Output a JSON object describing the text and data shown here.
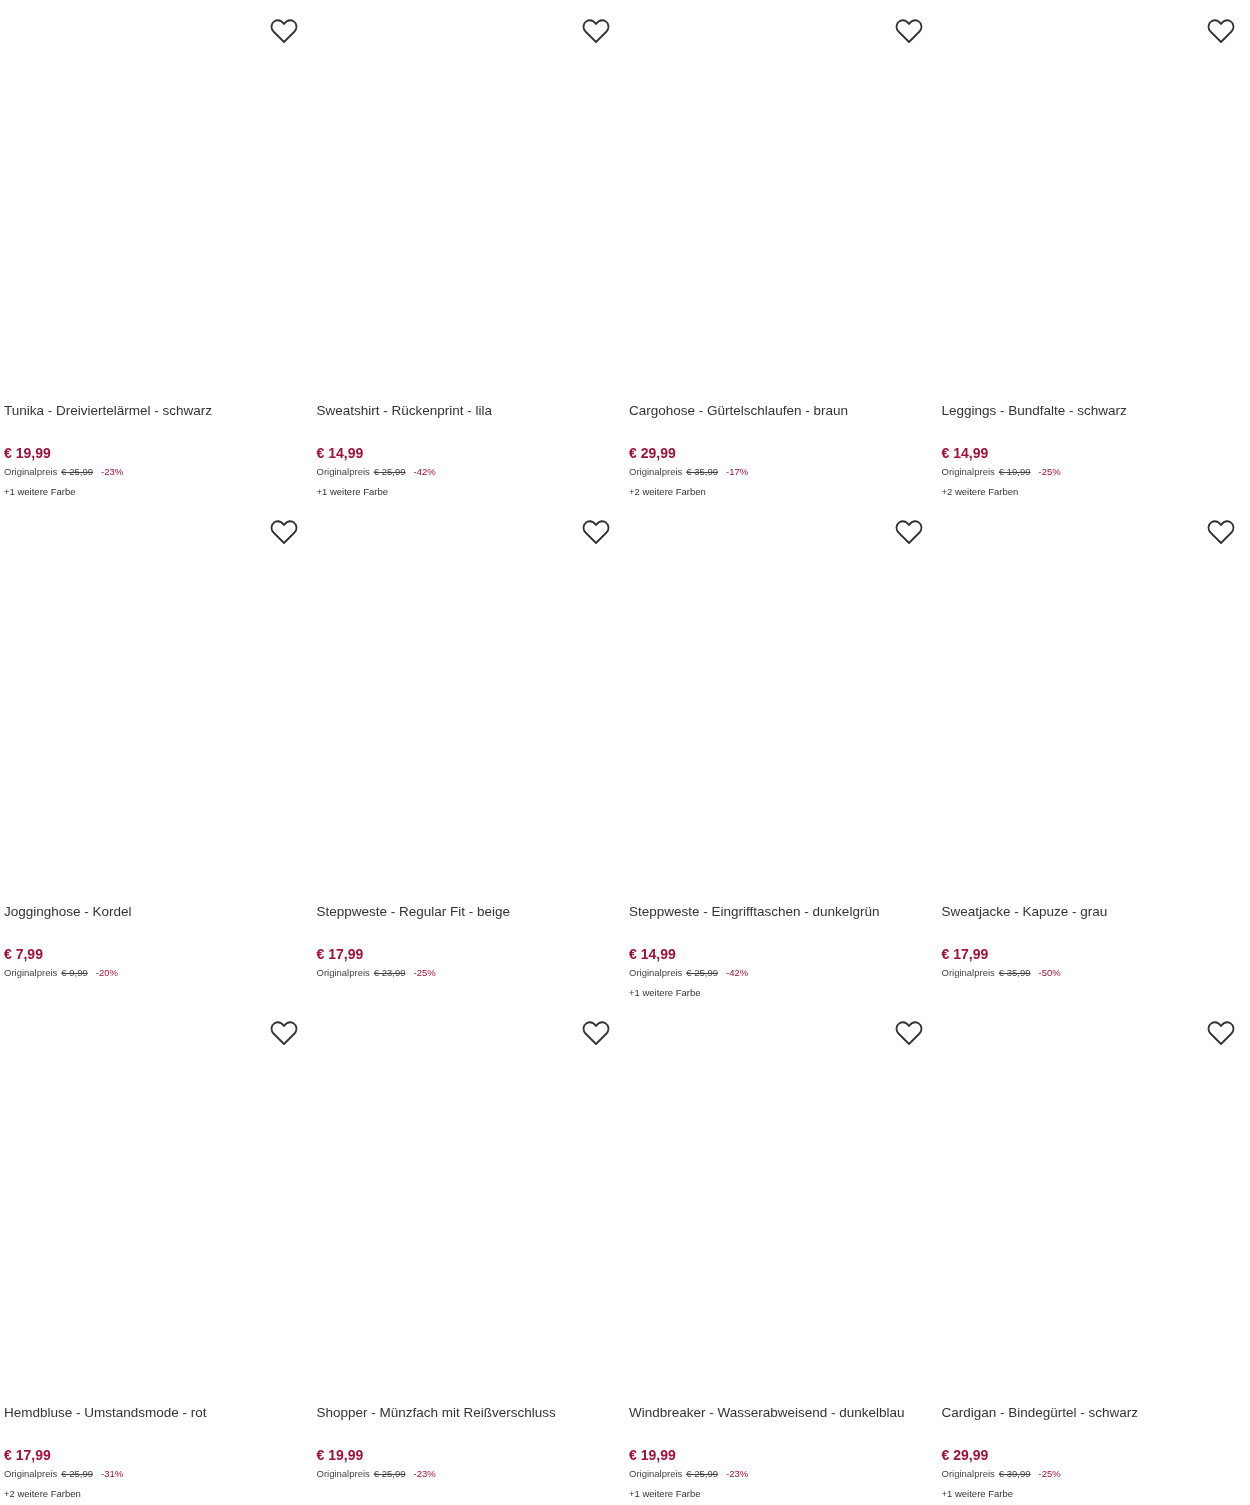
{
  "products": [
    {
      "title": "Tunika - Dreiviertelärmel - schwarz",
      "price": "€ 19,99",
      "original_label": "Originalpreis",
      "original_price": "€ 25,99",
      "discount": "-23%",
      "more_colors": "+1 weitere Farbe",
      "favorite": false
    },
    {
      "title": "Sweatshirt - Rückenprint - lila",
      "price": "€ 14,99",
      "original_label": "Originalpreis",
      "original_price": "€ 25,99",
      "discount": "-42%",
      "more_colors": "+1 weitere Farbe",
      "favorite": false
    },
    {
      "title": "Cargohose - Gürtelschlaufen - braun",
      "price": "€ 29,99",
      "original_label": "Originalpreis",
      "original_price": "€ 35,99",
      "discount": "-17%",
      "more_colors": "+2 weitere Farben",
      "favorite": false
    },
    {
      "title": "Leggings - Bundfalte - schwarz",
      "price": "€ 14,99",
      "original_label": "Originalpreis",
      "original_price": "€ 19,99",
      "discount": "-25%",
      "more_colors": "+2 weitere Farben",
      "favorite": false
    },
    {
      "title": "Jogginghose - Kordel",
      "price": "€ 7,99",
      "original_label": "Originalpreis",
      "original_price": "€ 9,99",
      "discount": "-20%",
      "favorite": false
    },
    {
      "title": "Steppweste - Regular Fit - beige",
      "price": "€ 17,99",
      "original_label": "Originalpreis",
      "original_price": "€ 23,99",
      "discount": "-25%",
      "favorite": false
    },
    {
      "title": "Steppweste - Eingrifftaschen - dunkelgrün",
      "price": "€ 14,99",
      "original_label": "Originalpreis",
      "original_price": "€ 25,99",
      "discount": "-42%",
      "more_colors": "+1 weitere Farbe",
      "favorite": false
    },
    {
      "title": "Sweatjacke - Kapuze - grau",
      "price": "€ 17,99",
      "original_label": "Originalpreis",
      "original_price": "€ 35,99",
      "discount": "-50%",
      "favorite": false
    },
    {
      "title": "Hemdbluse - Umstandsmode - rot",
      "price": "€ 17,99",
      "original_label": "Originalpreis",
      "original_price": "€ 25,99",
      "discount": "-31%",
      "more_colors": "+2 weitere Farben",
      "favorite": false
    },
    {
      "title": "Shopper - Münzfach mit Reißverschluss",
      "price": "€ 19,99",
      "original_label": "Originalpreis",
      "original_price": "€ 25,99",
      "discount": "-23%",
      "favorite": false
    },
    {
      "title": "Windbreaker - Wasserabweisend - dunkelblau",
      "price": "€ 19,99",
      "original_label": "Originalpreis",
      "original_price": "€ 25,99",
      "discount": "-23%",
      "more_colors": "+1 weitere Farbe",
      "favorite": false
    },
    {
      "title": "Cardigan - Bindegürtel - schwarz",
      "price": "€ 29,99",
      "original_label": "Originalpreis",
      "original_price": "€ 39,99",
      "discount": "-25%",
      "more_colors": "+1 weitere Farbe",
      "favorite": false
    }
  ]
}
